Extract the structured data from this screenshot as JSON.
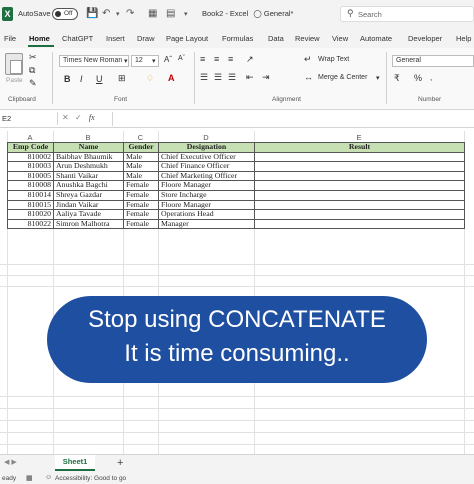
{
  "titlebar": {
    "logo": "X",
    "autosave_label": "AutoSave",
    "autosave_state": "Off",
    "title": "Book2 - Excel",
    "sensitivity": "General*",
    "search_placeholder": "Search"
  },
  "menu": {
    "tabs": [
      "File",
      "Home",
      "ChatGPT",
      "Insert",
      "Draw",
      "Page Layout",
      "Formulas",
      "Data",
      "Review",
      "View",
      "Automate",
      "Developer",
      "Help"
    ],
    "active": "Home"
  },
  "ribbon": {
    "paste_label": "Paste",
    "clipboard_label": "Clipboard",
    "font_name": "Times New Roman",
    "font_size": "12",
    "font_label": "Font",
    "bold": "B",
    "italic": "I",
    "underline": "U",
    "wrap_text": "Wrap Text",
    "merge_center": "Merge & Center",
    "alignment_label": "Alignment",
    "number_format": "General",
    "number_label": "Number"
  },
  "formula_bar": {
    "name_box": "E2",
    "fx": "fx",
    "content": ""
  },
  "grid": {
    "columns": [
      "A",
      "B",
      "C",
      "D",
      "E"
    ],
    "headers": [
      "Emp Code",
      "Name",
      "Gender",
      "Designation",
      "Result"
    ],
    "rows": [
      [
        "810002",
        "Baibhav Bhaumik",
        "Male",
        "Chief Executive Officer",
        ""
      ],
      [
        "810003",
        "Arun Deshmukh",
        "Male",
        "Chief Finance Officer",
        ""
      ],
      [
        "810005",
        "Shanti Vaikar",
        "Male",
        "Chief Marketing Officer",
        ""
      ],
      [
        "810008",
        "Anushka Bagchi",
        "Female",
        "Floore Manager",
        ""
      ],
      [
        "810014",
        "Shreya Gazdar",
        "Female",
        "Store Incharge",
        ""
      ],
      [
        "810015",
        "Jindan Vaikar",
        "Female",
        "Floore Manager",
        ""
      ],
      [
        "810020",
        "Aaliya Tavade",
        "Female",
        "Operations Head",
        ""
      ],
      [
        "810022",
        "Simron Malhotra",
        "Female",
        "Manager",
        ""
      ]
    ]
  },
  "banner": {
    "line1": "Stop using CONCATENATE",
    "line2": "It is time consuming..",
    "color": "#1f4fa0"
  },
  "sheets": {
    "tabs": [
      "Sheet1"
    ],
    "add": "+"
  },
  "status": {
    "ready": "eady",
    "accessibility": "Accessibility: Good to go"
  }
}
